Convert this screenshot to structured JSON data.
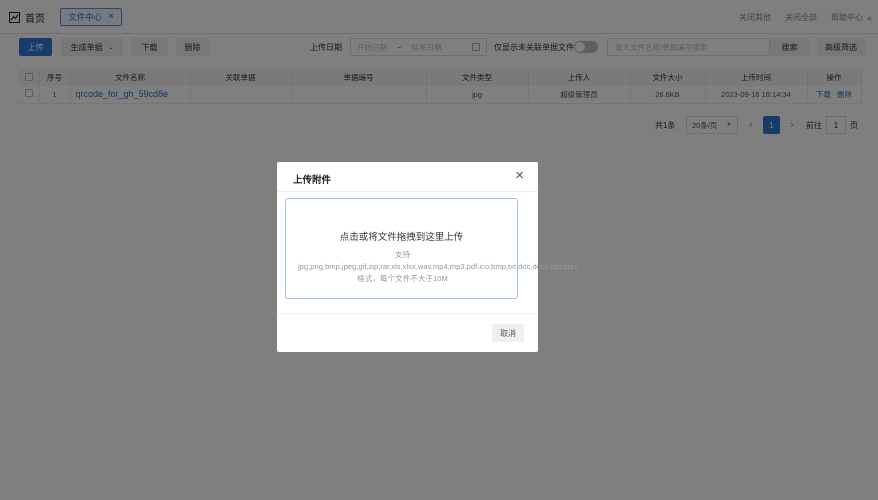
{
  "header": {
    "home_label": "首页",
    "active_tab": "文件中心",
    "right_actions": [
      "关闭其他",
      "关闭全部",
      "帮助中心"
    ],
    "collapse_glyph": "«"
  },
  "toolbar": {
    "upload": "上传",
    "generate_doc": "生成单据",
    "download": "下载",
    "delete": "删除",
    "upload_date_label": "上传日期",
    "start_date_placeholder": "开始日期",
    "range_separator": "~",
    "end_date_placeholder": "结束日期",
    "only_unlinked_label": "仅显示未关联单据文件",
    "only_unlinked_on": false,
    "search_placeholder": "输入文件名称/单据编号搜索",
    "search": "搜索",
    "advanced": "高级筛选"
  },
  "table": {
    "columns": [
      "序号",
      "文件名称",
      "关联单据",
      "单据编号",
      "文件类型",
      "上传人",
      "文件大小",
      "上传时间",
      "操作"
    ],
    "rows": [
      {
        "index": "1",
        "file_name": "qrcode_for_gh_59cd8e",
        "linked_doc": "",
        "doc_no": "",
        "file_type": "jpg",
        "uploader": "超级管理员",
        "size": "26.6KB",
        "time": "2023-09-16 18:14:34",
        "op_download": "下载",
        "op_delete": "删除"
      }
    ]
  },
  "pagination": {
    "total": "共1条",
    "page_size": "20条/页",
    "prev": "‹",
    "current": "1",
    "next": "›",
    "goto_label": "前往",
    "goto_value": "1",
    "page_unit": "页"
  },
  "modal": {
    "title": "上传附件",
    "close": "×",
    "drop_text": "点击或将文件拖拽到这里上传",
    "hint": "支持jpg,png,bmp,jpeg,gif,zip,rar,xls,xlsx,wav,mp4,mp3,pdf,ico,bmp,txt,doc,docx,ppt,pptx格式，每个文件不大于10M",
    "cancel": "取消"
  },
  "colors": {
    "primary": "#2f78d4",
    "link": "#2f6fcb",
    "overlay": "rgba(0,0,0,0.5)"
  }
}
